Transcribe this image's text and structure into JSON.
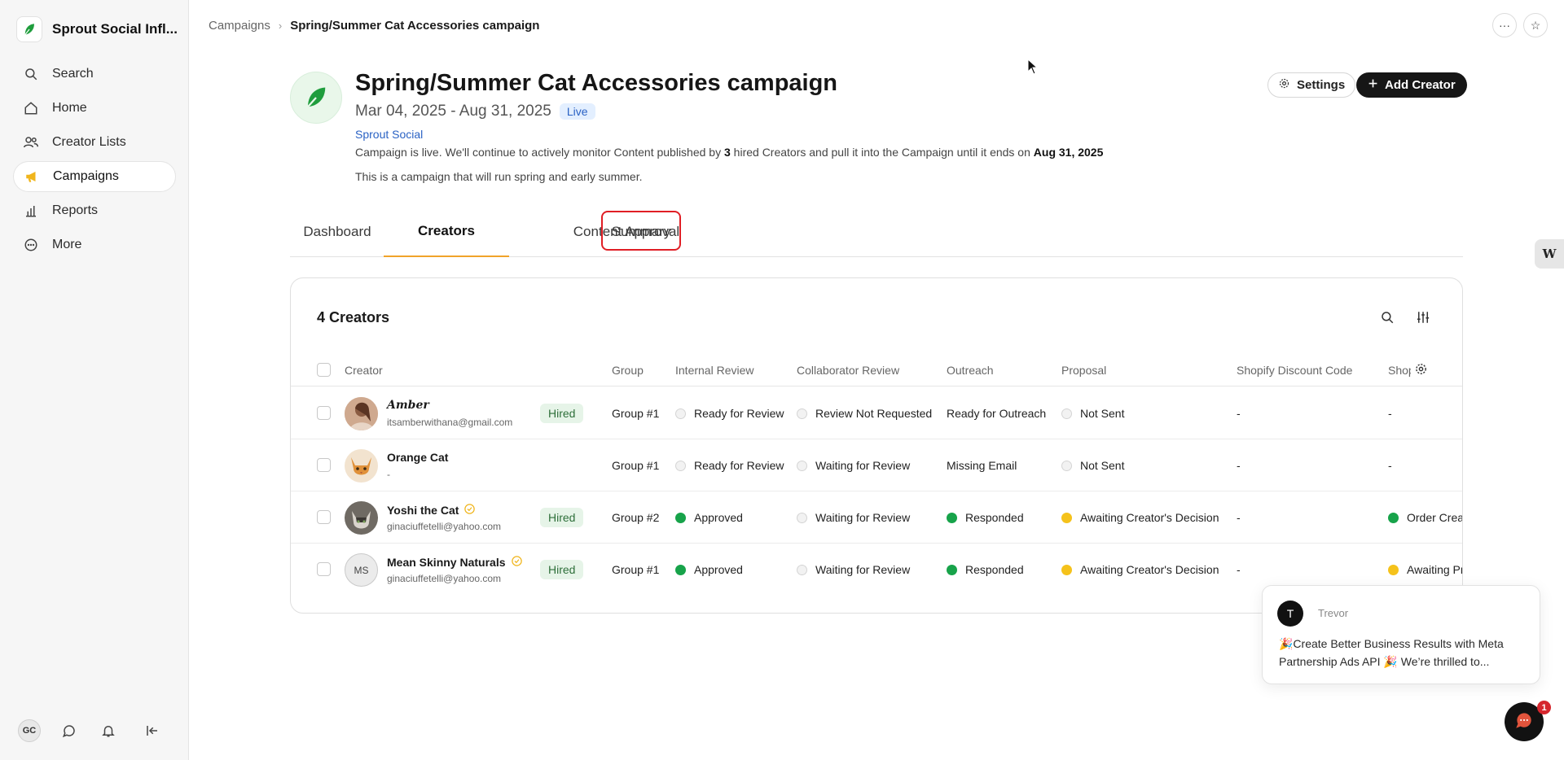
{
  "brand": {
    "name": "Sprout Social Infl..."
  },
  "nav": {
    "items": [
      {
        "label": "Search",
        "icon": "search-icon"
      },
      {
        "label": "Home",
        "icon": "home-icon"
      },
      {
        "label": "Creator Lists",
        "icon": "users-icon"
      },
      {
        "label": "Campaigns",
        "icon": "megaphone-icon",
        "active": true
      },
      {
        "label": "Reports",
        "icon": "bar-chart-icon"
      },
      {
        "label": "More",
        "icon": "more-circle-icon"
      }
    ]
  },
  "footer": {
    "avatar_initials": "GC"
  },
  "breadcrumb": {
    "parent": "Campaigns",
    "separator": "›",
    "current": "Spring/Summer Cat Accessories campaign"
  },
  "top_actions": {
    "more": "···",
    "favorite": "☆"
  },
  "campaign": {
    "title": "Spring/Summer Cat Accessories campaign",
    "dates": "Mar 04, 2025 - Aug 31, 2025",
    "status_badge": "Live",
    "organization": "Sprout Social",
    "status_prefix": "Campaign is live. We'll continue to actively monitor Content published by",
    "hired_count": "3",
    "status_middle": "hired Creators and pull it into the Campaign until it ends on",
    "end_date": "Aug 31, 2025",
    "description": "This is a campaign that will run spring and early summer."
  },
  "actions": {
    "settings": "Settings",
    "add_creator": "Add Creator"
  },
  "tabs": [
    {
      "label": "Dashboard"
    },
    {
      "label": "Creators",
      "active": true
    },
    {
      "label": "Content Approval"
    },
    {
      "label": "Summary",
      "highlighted": true
    }
  ],
  "table": {
    "title": "4 Creators",
    "columns": [
      "Creator",
      "Group",
      "Internal Review",
      "Collaborator Review",
      "Outreach",
      "Proposal",
      "Shopify Discount Code",
      "Shop"
    ],
    "rows": [
      {
        "name": "Amber",
        "email": "itsamberwithana@gmail.com",
        "hired": "Hired",
        "verified": false,
        "group": "Group #1",
        "internal_review": "Ready for Review",
        "internal_dot": "empty",
        "collab_review": "Review Not Requested",
        "collab_dot": "empty",
        "outreach": "Ready for Outreach",
        "outreach_dot": "none",
        "proposal": "Not Sent",
        "proposal_dot": "empty",
        "discount": "-",
        "shop": "-",
        "shop_dot": "none"
      },
      {
        "name": "Orange Cat",
        "email": "-",
        "hired": "",
        "verified": false,
        "group": "Group #1",
        "internal_review": "Ready for Review",
        "internal_dot": "empty",
        "collab_review": "Waiting for Review",
        "collab_dot": "empty",
        "outreach": "Missing Email",
        "outreach_dot": "none",
        "proposal": "Not Sent",
        "proposal_dot": "empty",
        "discount": "-",
        "shop": "-",
        "shop_dot": "none"
      },
      {
        "name": "Yoshi the Cat",
        "email": "ginaciuffetelli@yahoo.com",
        "hired": "Hired",
        "verified": true,
        "group": "Group #2",
        "internal_review": "Approved",
        "internal_dot": "green",
        "collab_review": "Waiting for Review",
        "collab_dot": "empty",
        "outreach": "Responded",
        "outreach_dot": "green",
        "proposal": "Awaiting Creator's Decision",
        "proposal_dot": "yellow",
        "discount": "-",
        "shop": "Order Crea",
        "shop_dot": "green"
      },
      {
        "name": "Mean Skinny Naturals",
        "initials": "MS",
        "email": "ginaciuffetelli@yahoo.com",
        "hired": "Hired",
        "verified": true,
        "group": "Group #1",
        "internal_review": "Approved",
        "internal_dot": "green",
        "collab_review": "Waiting for Review",
        "collab_dot": "empty",
        "outreach": "Responded",
        "outreach_dot": "green",
        "proposal": "Awaiting Creator's Decision",
        "proposal_dot": "yellow",
        "discount": "-",
        "shop": "Awaiting Pr",
        "shop_dot": "yellow"
      }
    ]
  },
  "chat": {
    "sender_initial": "T",
    "sender": "Trevor",
    "message": "🎉Create Better Business Results with Meta Partnership Ads API 🎉 We’re thrilled to...",
    "unread": "1"
  },
  "side_widget": {
    "label": "W"
  },
  "colors": {
    "accent": "#f0a32a",
    "brand_green": "#1f9d3d",
    "highlight": "#e01e25",
    "link": "#2a62c4"
  }
}
